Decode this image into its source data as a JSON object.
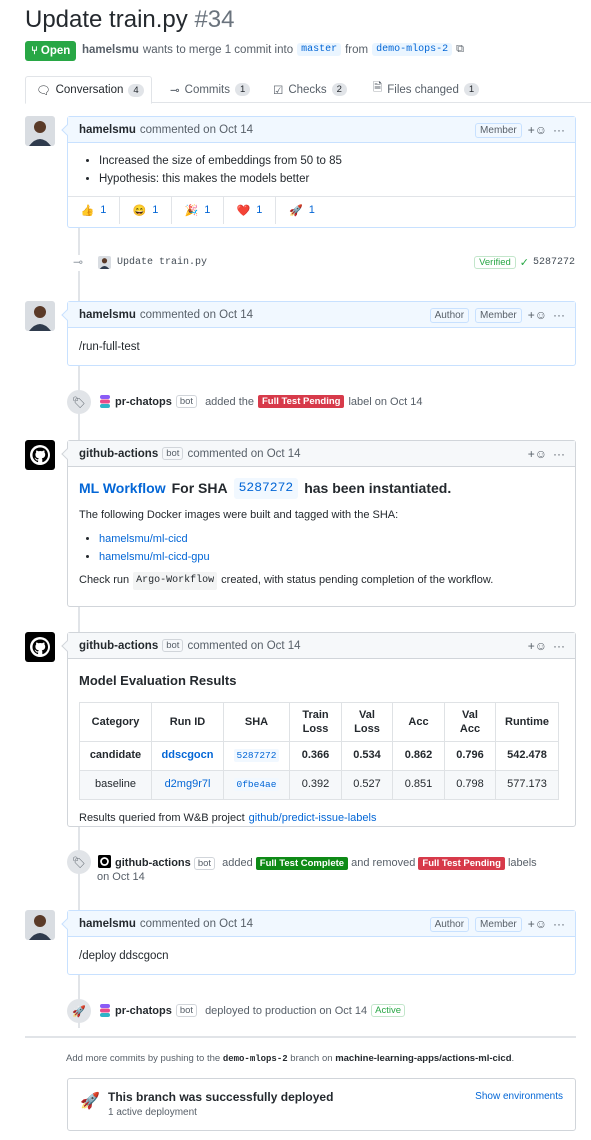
{
  "header": {
    "title": "Update train.py",
    "number": "#34",
    "state": "Open",
    "author": "hamelsmu",
    "merge_text": "wants to merge 1 commit into",
    "base_branch": "master",
    "from_text": "from",
    "head_branch": "demo-mlops-2"
  },
  "tabs": [
    {
      "label": "Conversation",
      "count": "4"
    },
    {
      "label": "Commits",
      "count": "1"
    },
    {
      "label": "Checks",
      "count": "2"
    },
    {
      "label": "Files changed",
      "count": "1"
    }
  ],
  "comment1": {
    "author": "hamelsmu",
    "meta": "commented on Oct 14",
    "role": "Member",
    "bullets": [
      "Increased the size of embeddings from 50 to 85",
      "Hypothesis: this makes the models better"
    ],
    "reactions": [
      {
        "emoji": "👍",
        "count": "1"
      },
      {
        "emoji": "😄",
        "count": "1"
      },
      {
        "emoji": "🎉",
        "count": "1"
      },
      {
        "emoji": "❤️",
        "count": "1"
      },
      {
        "emoji": "🚀",
        "count": "1"
      }
    ]
  },
  "commit": {
    "message": "Update train.py",
    "verified": "Verified",
    "sha": "5287272"
  },
  "comment2": {
    "author": "hamelsmu",
    "meta": "commented on Oct 14",
    "role1": "Author",
    "role2": "Member",
    "body": "/run-full-test"
  },
  "label_event1": {
    "actor": "pr-chatops",
    "bot": "bot",
    "verb": "added the",
    "label": "Full Test Pending",
    "suffix": "label on Oct 14"
  },
  "comment3": {
    "author": "github-actions",
    "bot": "bot",
    "meta": "commented on Oct 14",
    "heading_link": "ML Workflow",
    "heading_mid": "For SHA",
    "heading_sha": "5287272",
    "heading_end": "has been instantiated.",
    "para1": "The following Docker images were built and tagged with the SHA:",
    "images": [
      "hamelsmu/ml-cicd",
      "hamelsmu/ml-cicd-gpu"
    ],
    "check_pre": "Check run",
    "check_code": "Argo-Workflow",
    "check_post": "created, with status pending completion of the workflow."
  },
  "comment4": {
    "author": "github-actions",
    "bot": "bot",
    "meta": "commented on Oct 14",
    "heading": "Model Evaluation Results",
    "columns": [
      "Category",
      "Run ID",
      "SHA",
      "Train Loss",
      "Val Loss",
      "Acc",
      "Val Acc",
      "Runtime"
    ],
    "rows": [
      {
        "category": "candidate",
        "run_id": "ddscgocn",
        "sha": "5287272",
        "train_loss": "0.366",
        "val_loss": "0.534",
        "acc": "0.862",
        "val_acc": "0.796",
        "runtime": "542.478"
      },
      {
        "category": "baseline",
        "run_id": "d2mg9r7l",
        "sha": "0fbe4ae",
        "train_loss": "0.392",
        "val_loss": "0.527",
        "acc": "0.851",
        "val_acc": "0.798",
        "runtime": "577.173"
      }
    ],
    "footer_text": "Results queried from W&B project",
    "footer_link": "github/predict-issue-labels"
  },
  "label_event2": {
    "actor": "github-actions",
    "bot": "bot",
    "verb": "added",
    "label_add": "Full Test Complete",
    "mid": "and removed",
    "label_remove": "Full Test Pending",
    "suffix": "labels",
    "date": "on Oct 14"
  },
  "comment5": {
    "author": "hamelsmu",
    "meta": "commented on Oct 14",
    "role1": "Author",
    "role2": "Member",
    "body": "/deploy ddscgocn"
  },
  "deploy_event": {
    "actor": "pr-chatops",
    "bot": "bot",
    "text": "deployed to production on Oct 14",
    "status": "Active"
  },
  "footer": {
    "pre": "Add more commits by pushing to the",
    "branch": "demo-mlops-2",
    "mid": "branch on",
    "repo": "machine-learning-apps/actions-ml-cicd",
    "end": "."
  },
  "deploy_box": {
    "title": "This branch was successfully deployed",
    "subtitle": "1 active deployment",
    "link": "Show environments"
  },
  "colors": {
    "open": "#28a745",
    "link": "#0366d6",
    "label_pending": "#d73a4a",
    "label_complete": "#0e8a16"
  }
}
